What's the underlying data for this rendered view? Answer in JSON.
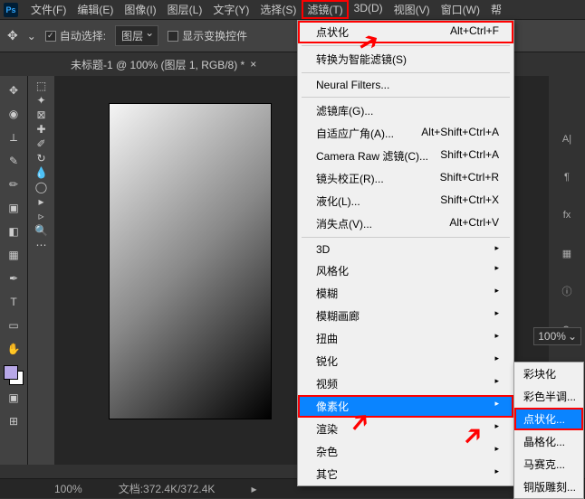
{
  "app": {
    "logo": "Ps"
  },
  "menubar": [
    "文件(F)",
    "编辑(E)",
    "图像(I)",
    "图层(L)",
    "文字(Y)",
    "选择(S)",
    "滤镜(T)",
    "3D(D)",
    "视图(V)",
    "窗口(W)",
    "帮"
  ],
  "menubar_highlight_index": 6,
  "options": {
    "auto_select_label": "自动选择:",
    "layer_dropdown": "图层",
    "show_transform_label": "显示变换控件"
  },
  "document_tab": "未标题-1 @ 100% (图层 1, RGB/8) *",
  "statusbar": {
    "zoom": "100%",
    "filesize": "文档:372.4K/372.4K"
  },
  "filter_menu": {
    "items": [
      {
        "label": "点状化",
        "shortcut": "Alt+Ctrl+F",
        "highlight": true
      },
      {
        "sep": true
      },
      {
        "label": "转换为智能滤镜(S)"
      },
      {
        "sep": true
      },
      {
        "label": "Neural Filters..."
      },
      {
        "sep": true
      },
      {
        "label": "滤镜库(G)..."
      },
      {
        "label": "自适应广角(A)...",
        "shortcut": "Alt+Shift+Ctrl+A"
      },
      {
        "label": "Camera Raw 滤镜(C)...",
        "shortcut": "Shift+Ctrl+A"
      },
      {
        "label": "镜头校正(R)...",
        "shortcut": "Shift+Ctrl+R"
      },
      {
        "label": "液化(L)...",
        "shortcut": "Shift+Ctrl+X"
      },
      {
        "label": "消失点(V)...",
        "shortcut": "Alt+Ctrl+V"
      },
      {
        "sep": true
      },
      {
        "label": "3D",
        "sub": true
      },
      {
        "label": "风格化",
        "sub": true
      },
      {
        "label": "模糊",
        "sub": true
      },
      {
        "label": "模糊画廊",
        "sub": true
      },
      {
        "label": "扭曲",
        "sub": true
      },
      {
        "label": "锐化",
        "sub": true
      },
      {
        "label": "视频",
        "sub": true
      },
      {
        "label": "像素化",
        "sub": true,
        "selected": true,
        "highlight": true
      },
      {
        "label": "渲染",
        "sub": true
      },
      {
        "label": "杂色",
        "sub": true
      },
      {
        "label": "其它",
        "sub": true
      }
    ]
  },
  "pixelate_submenu": {
    "items": [
      {
        "label": "彩块化"
      },
      {
        "label": "彩色半调..."
      },
      {
        "label": "点状化...",
        "selected": true
      },
      {
        "label": "晶格化..."
      },
      {
        "label": "马赛克..."
      },
      {
        "label": "铜版雕刻..."
      }
    ]
  },
  "right_controls": {
    "opacity_value": "100%"
  }
}
